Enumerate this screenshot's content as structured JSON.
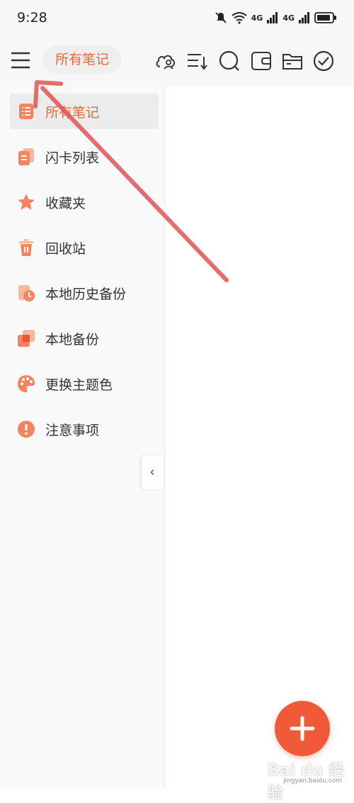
{
  "status_bar": {
    "time": "9:28",
    "signal_labels": [
      "4G",
      "4G"
    ]
  },
  "header": {
    "title": "所有笔记"
  },
  "toolbar": {
    "icons": [
      "cloud-user-icon",
      "sort-icon",
      "search-icon",
      "wallet-icon",
      "folder-icon",
      "check-circle-icon"
    ]
  },
  "sidebar": {
    "items": [
      {
        "label": "所有笔记",
        "icon": "notes-list-icon",
        "active": true
      },
      {
        "label": "闪卡列表",
        "icon": "flashcards-icon",
        "active": false
      },
      {
        "label": "收藏夹",
        "icon": "star-icon",
        "active": false
      },
      {
        "label": "回收站",
        "icon": "trash-icon",
        "active": false
      },
      {
        "label": "本地历史备份",
        "icon": "history-backup-icon",
        "active": false
      },
      {
        "label": "本地备份",
        "icon": "backup-icon",
        "active": false
      },
      {
        "label": "更换主题色",
        "icon": "palette-icon",
        "active": false
      },
      {
        "label": "注意事项",
        "icon": "warning-icon",
        "active": false
      }
    ],
    "collapse_glyph": "‹"
  },
  "fab": {
    "icon": "plus-icon"
  },
  "watermark": {
    "text": "Bai du 经验",
    "sub": "jingyan.baidu.com"
  },
  "colors": {
    "accent": "#f06535",
    "icon_orange": "#f4845f",
    "annotation_red": "#e05555"
  }
}
